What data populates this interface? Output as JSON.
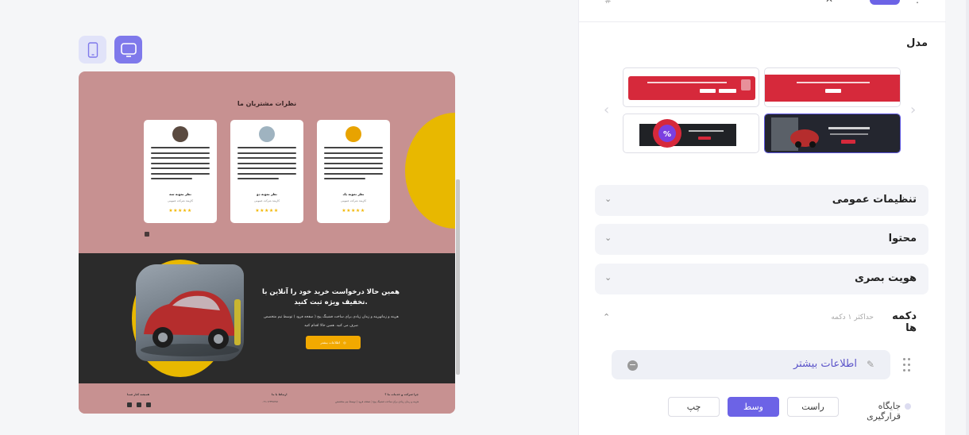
{
  "preview": {
    "testimonials": {
      "title": "نظرات مشتریان ما",
      "cards": [
        {
          "name": "نظر نمونه یک",
          "role": "کارمند شرکت عمومی",
          "stars": "★★★★★"
        },
        {
          "name": "نظر نمونه دو",
          "role": "کارمند شرکت عمومی",
          "stars": "★★★★★"
        },
        {
          "name": "نظر نمونه سه",
          "role": "کارمند شرکت عمومی",
          "stars": "★★★★★"
        }
      ]
    },
    "promo": {
      "title": "همین حالا درخواست خرید خود را آنلاین با تخفیف ویژه ثبت کنید.",
      "text": "هزینه و زمانهزینه و زمان زیادی برای ساخت فشینگ پیج ( صفحه فرود ) توسط تیم متخصص صرف می کنید. همین حالا اقدام کنید",
      "button": "اطلاعات بیشتر"
    },
    "footer": {
      "col1_title": "چرا شرکت و خدمات ما ؟",
      "col1_text": "هزینه و زمان زیادی برای ساخت فشینگ پیج ( صفحه فرود ) توسط تیم متخصص",
      "col2_title": "ارتباط با ما",
      "col2_text": "۰۲۱-۱۲۳۴۵۶۷۸",
      "col3_title": "همیشه کنار شما"
    }
  },
  "panel": {
    "model_label": "مدل",
    "accordions": [
      {
        "label": "تنظیمات عمومی"
      },
      {
        "label": "محتوا"
      },
      {
        "label": "هویت بصری"
      }
    ],
    "buttons_section": {
      "title": "دکمه ها",
      "subtitle": "حداکثر ۱ دکمه",
      "item_label": "اطلاعات بیشتر"
    },
    "position": {
      "label": "جایگاه قرارگیری",
      "options": [
        "راست",
        "وسط",
        "چپ"
      ],
      "selected": "وسط"
    }
  },
  "colors": {
    "accent": "#6c63e6",
    "preview_pink": "#c79191",
    "preview_dark": "#2b2b2b",
    "preview_yellow": "#e8b800"
  }
}
